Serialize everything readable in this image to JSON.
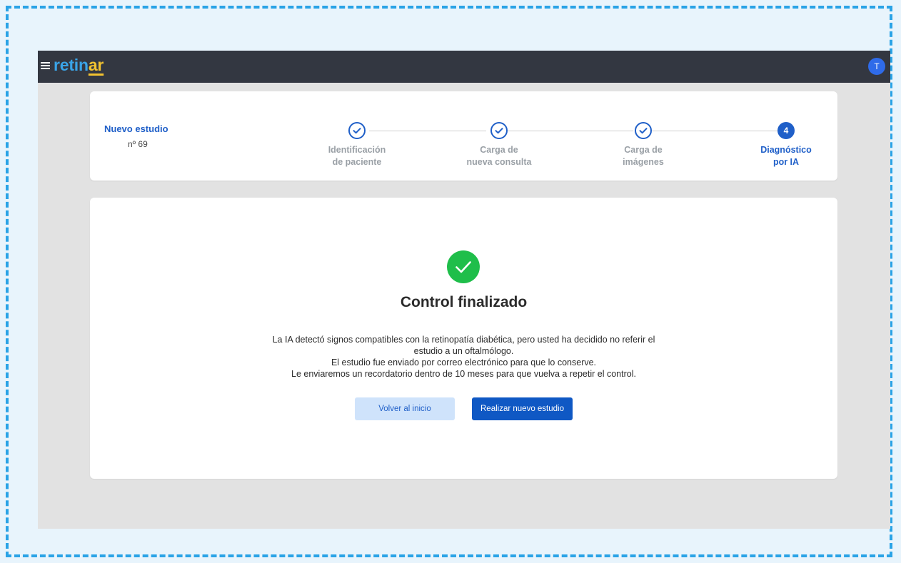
{
  "header": {
    "logo_part1": "retin",
    "logo_part2": "ar",
    "avatar_initial": "T",
    "menu_icon": "hamburger-menu-icon"
  },
  "study": {
    "title": "Nuevo estudio",
    "number": "nº 69"
  },
  "steps": [
    {
      "line1": "Identificación",
      "line2": "de paciente",
      "status": "done"
    },
    {
      "line1": "Carga de",
      "line2": "nueva consulta",
      "status": "done"
    },
    {
      "line1": "Carga de",
      "line2": "imágenes",
      "status": "done"
    },
    {
      "line1": "Diagnóstico",
      "line2": "por IA",
      "status": "active",
      "number": "4"
    }
  ],
  "result": {
    "icon": "check-circle-icon",
    "title": "Control finalizado",
    "message_lines": [
      "La IA detectó signos compatibles con la retinopatía diabética, pero usted ha decidido no referir el",
      "estudio a un oftalmólogo.",
      "El estudio fue enviado por correo electrónico para que lo conserve.",
      "Le enviaremos un recordatorio dentro de 10 meses para que vuelva a repetir el control."
    ],
    "secondary_button": "Volver al inicio",
    "primary_button": "Realizar nuevo estudio"
  },
  "colors": {
    "accent": "#1f5fc8",
    "success": "#1fbe4a",
    "topbar": "#333741"
  }
}
